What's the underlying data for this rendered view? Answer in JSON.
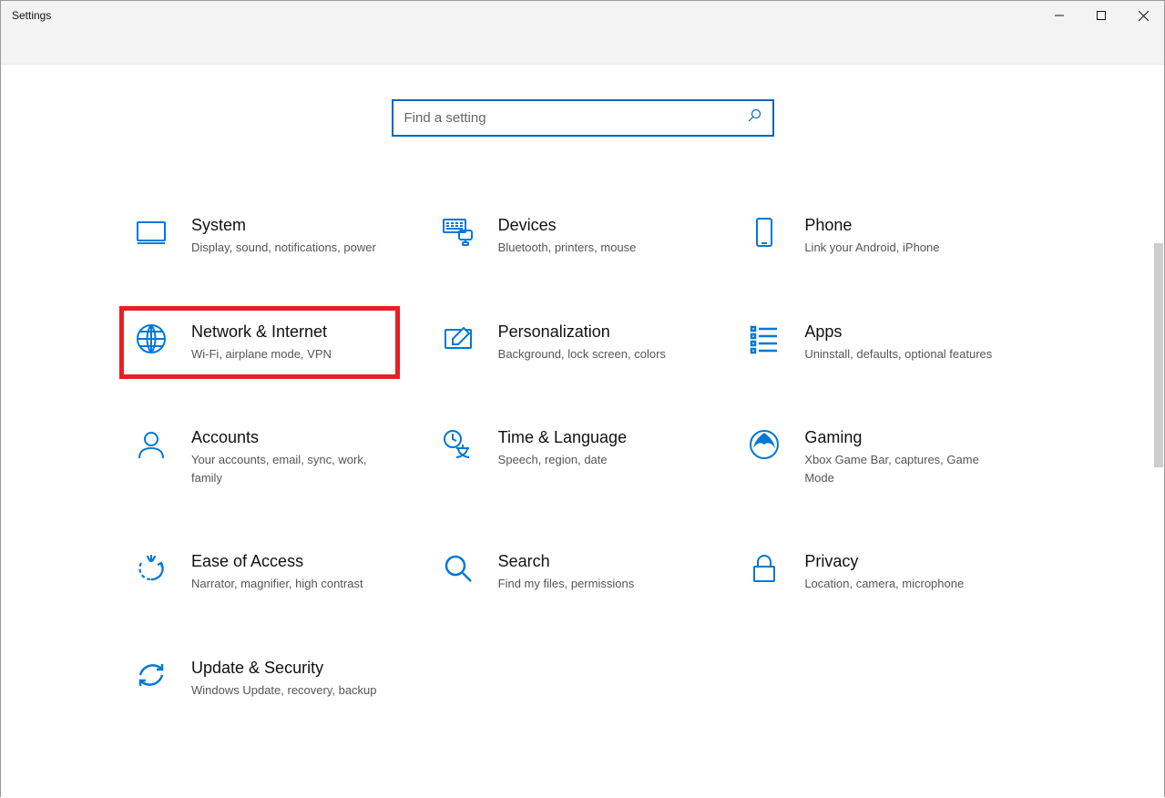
{
  "window": {
    "title": "Settings"
  },
  "search": {
    "placeholder": "Find a setting"
  },
  "categories": [
    {
      "id": "system",
      "title": "System",
      "desc": "Display, sound, notifications, power",
      "highlight": false
    },
    {
      "id": "devices",
      "title": "Devices",
      "desc": "Bluetooth, printers, mouse",
      "highlight": false
    },
    {
      "id": "phone",
      "title": "Phone",
      "desc": "Link your Android, iPhone",
      "highlight": false
    },
    {
      "id": "network",
      "title": "Network & Internet",
      "desc": "Wi-Fi, airplane mode, VPN",
      "highlight": true
    },
    {
      "id": "personalization",
      "title": "Personalization",
      "desc": "Background, lock screen, colors",
      "highlight": false
    },
    {
      "id": "apps",
      "title": "Apps",
      "desc": "Uninstall, defaults, optional features",
      "highlight": false
    },
    {
      "id": "accounts",
      "title": "Accounts",
      "desc": "Your accounts, email, sync, work, family",
      "highlight": false
    },
    {
      "id": "time-language",
      "title": "Time & Language",
      "desc": "Speech, region, date",
      "highlight": false
    },
    {
      "id": "gaming",
      "title": "Gaming",
      "desc": "Xbox Game Bar, captures, Game Mode",
      "highlight": false
    },
    {
      "id": "ease-of-access",
      "title": "Ease of Access",
      "desc": "Narrator, magnifier, high contrast",
      "highlight": false
    },
    {
      "id": "search",
      "title": "Search",
      "desc": "Find my files, permissions",
      "highlight": false
    },
    {
      "id": "privacy",
      "title": "Privacy",
      "desc": "Location, camera, microphone",
      "highlight": false
    },
    {
      "id": "update-security",
      "title": "Update & Security",
      "desc": "Windows Update, recovery, backup",
      "highlight": false
    }
  ]
}
